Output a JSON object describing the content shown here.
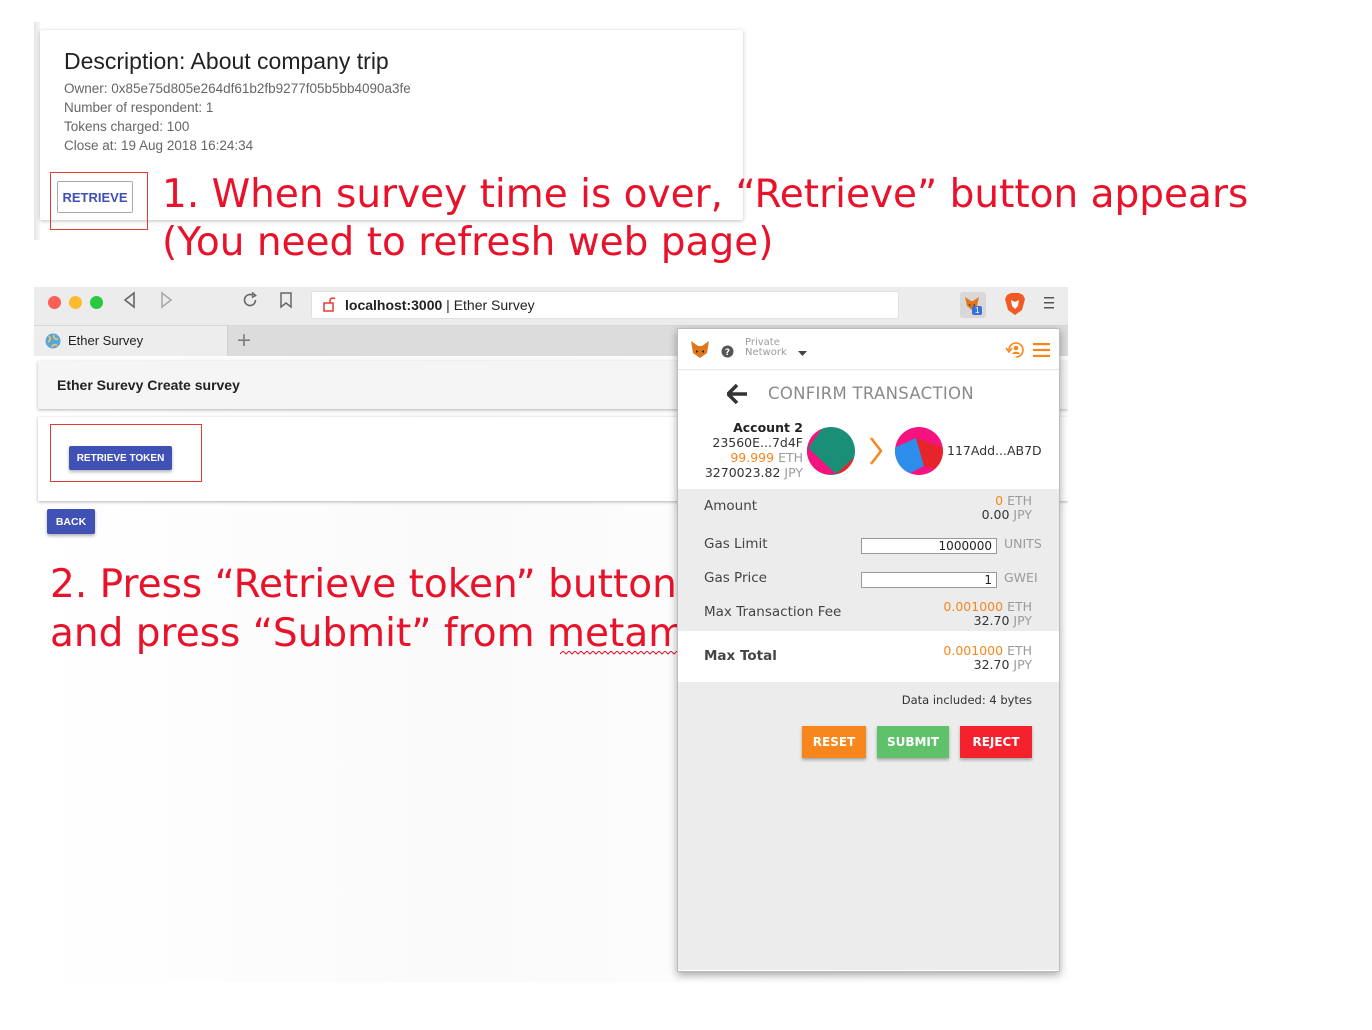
{
  "card": {
    "title": "Description: About company trip",
    "owner": "Owner: 0x85e75d805e264df61b2fb9277f05b5bb4090a3fe",
    "respondents": "Number of respondent: 1",
    "tokens": "Tokens charged: 100",
    "close": "Close at: 19 Aug 2018 16:24:34",
    "retrieve_label": "RETRIEVE"
  },
  "annotations": {
    "step1_line1": "1.  When survey time is over, “Retrieve” button appears",
    "step1_line2": "(You need to refresh web page)",
    "step2_line1": "2. Press “Retrieve token” button",
    "step2_line2": "and press “Submit” from metamask"
  },
  "browser": {
    "url_host": "localhost:3000",
    "url_separator": " | ",
    "url_title": "Ether Survey",
    "tab_title": "Ether Survey",
    "new_tab": "+",
    "extension_badge": "1"
  },
  "app": {
    "appbar_title": "Ether Surevy Create survey",
    "retrieve_token_label": "RETRIEVE TOKEN",
    "back_label": "BACK"
  },
  "metamask": {
    "network_line1": "Private",
    "network_line2": "Network",
    "heading": "CONFIRM TRANSACTION",
    "account_name": "Account 2",
    "account_address": "23560E...7d4F",
    "account_eth_value": "99.999",
    "account_eth_unit": "ETH",
    "account_jpy_value": "3270023.82",
    "account_jpy_unit": "JPY",
    "recipient": "117Add...AB7D",
    "amount_label": "Amount",
    "amount_eth": "0",
    "amount_eth_unit": "ETH",
    "amount_jpy": "0.00",
    "amount_jpy_unit": "JPY",
    "gas_limit_label": "Gas Limit",
    "gas_limit_value": "1000000",
    "gas_limit_unit": "UNITS",
    "gas_price_label": "Gas Price",
    "gas_price_value": "1",
    "gas_price_unit": "GWEI",
    "max_fee_label": "Max Transaction Fee",
    "max_fee_eth": "0.001000",
    "max_fee_eth_unit": "ETH",
    "max_fee_jpy": "32.70",
    "max_fee_jpy_unit": "JPY",
    "max_total_label": "Max Total",
    "max_total_eth": "0.001000",
    "max_total_eth_unit": "ETH",
    "max_total_jpy": "32.70",
    "max_total_jpy_unit": "JPY",
    "data_included": "Data included: 4 bytes",
    "reset_label": "RESET",
    "submit_label": "SUBMIT",
    "reject_label": "REJECT"
  },
  "colors": {
    "annotation_red": "#e8122b",
    "primary_blue": "#3f51b5",
    "metamask_orange": "#f7861c",
    "submit_green": "#5fc26a",
    "reject_red": "#f5212d"
  }
}
